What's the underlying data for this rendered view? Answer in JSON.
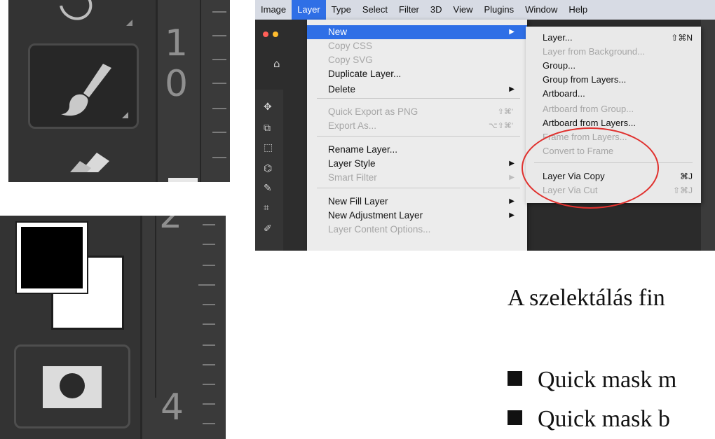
{
  "brush_panel": {
    "ruler_numbers": [
      "1",
      "0"
    ]
  },
  "color_panel": {
    "ruler_numbers": [
      "2",
      "4"
    ],
    "foreground_color": "#000000",
    "background_color": "#ffffff"
  },
  "photoshop": {
    "menubar": [
      "Image",
      "Layer",
      "Type",
      "Select",
      "Filter",
      "3D",
      "View",
      "Plugins",
      "Window",
      "Help"
    ],
    "active_menu": "Layer",
    "layer_menu": [
      {
        "label": "New",
        "shortcut": "",
        "submenu": true,
        "disabled": false,
        "highlighted": true
      },
      {
        "label": "Copy CSS",
        "shortcut": "",
        "submenu": false,
        "disabled": true
      },
      {
        "label": "Copy SVG",
        "shortcut": "",
        "submenu": false,
        "disabled": true
      },
      {
        "label": "Duplicate Layer...",
        "shortcut": "",
        "submenu": false,
        "disabled": false
      },
      {
        "label": "Delete",
        "shortcut": "",
        "submenu": true,
        "disabled": false
      },
      {
        "label": "Quick Export as PNG",
        "shortcut": "⇧⌘'",
        "submenu": false,
        "disabled": true
      },
      {
        "label": "Export As...",
        "shortcut": "⌥⇧⌘'",
        "submenu": false,
        "disabled": true
      },
      {
        "label": "Rename Layer...",
        "shortcut": "",
        "submenu": false,
        "disabled": false
      },
      {
        "label": "Layer Style",
        "shortcut": "",
        "submenu": true,
        "disabled": false
      },
      {
        "label": "Smart Filter",
        "shortcut": "",
        "submenu": true,
        "disabled": true
      },
      {
        "label": "New Fill Layer",
        "shortcut": "",
        "submenu": true,
        "disabled": false
      },
      {
        "label": "New Adjustment Layer",
        "shortcut": "",
        "submenu": true,
        "disabled": false
      },
      {
        "label": "Layer Content Options...",
        "shortcut": "",
        "submenu": false,
        "disabled": true
      }
    ],
    "new_submenu": [
      {
        "label": "Layer...",
        "shortcut": "⇧⌘N",
        "disabled": false
      },
      {
        "label": "Layer from Background...",
        "shortcut": "",
        "disabled": true
      },
      {
        "label": "Group...",
        "shortcut": "",
        "disabled": false
      },
      {
        "label": "Group from Layers...",
        "shortcut": "",
        "disabled": false
      },
      {
        "label": "Artboard...",
        "shortcut": "",
        "disabled": false
      },
      {
        "label": "Artboard from Group...",
        "shortcut": "",
        "disabled": true
      },
      {
        "label": "Artboard from Layers...",
        "shortcut": "",
        "disabled": false
      },
      {
        "label": "Frame from Layers...",
        "shortcut": "",
        "disabled": true
      },
      {
        "label": "Convert to Frame",
        "shortcut": "",
        "disabled": true
      },
      {
        "label": "Layer Via Copy",
        "shortcut": "⌘J",
        "disabled": false
      },
      {
        "label": "Layer Via Cut",
        "shortcut": "⇧⌘J",
        "disabled": true
      }
    ],
    "accent_color": "#2f6fe6",
    "annotation_color": "#e0312e"
  },
  "slide": {
    "heading": "A szelektálás fin",
    "bullets": [
      "Quick mask m",
      "Quick mask b"
    ]
  }
}
